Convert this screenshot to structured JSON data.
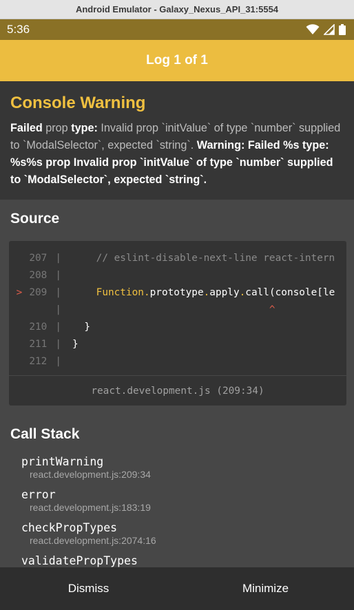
{
  "window": {
    "title": "Android Emulator - Galaxy_Nexus_API_31:5554"
  },
  "statusbar": {
    "time": "5:36",
    "icons": [
      "wifi-icon",
      "signal-icon",
      "battery-icon"
    ]
  },
  "header": {
    "title": "Log 1 of 1"
  },
  "warning": {
    "title": "Console Warning",
    "parts": [
      {
        "text": "Failed ",
        "style": "bright"
      },
      {
        "text": "prop ",
        "style": "dim"
      },
      {
        "text": "type: ",
        "style": "bright"
      },
      {
        "text": "Invalid prop `initValue` of type `number` supplied to `ModalSelector`, expected `string`.",
        "style": "dim"
      },
      {
        "text": " Warning: Failed %s type: %s%s prop Invalid prop `initValue` of type `number` supplied to `ModalSelector`, expected `string`.",
        "style": "bright"
      }
    ]
  },
  "source": {
    "title": "Source",
    "lines": [
      {
        "num": "207",
        "marker": "",
        "code": "    // eslint-disable-next-line react-intern"
      },
      {
        "num": "208",
        "marker": "",
        "code": ""
      },
      {
        "num": "209",
        "marker": ">",
        "code": "    Function.prototype.apply.call(console[le"
      },
      {
        "num": "",
        "marker": "",
        "code": "                                 ^"
      },
      {
        "num": "210",
        "marker": "",
        "code": "  }"
      },
      {
        "num": "211",
        "marker": "",
        "code": "}"
      },
      {
        "num": "212",
        "marker": "",
        "code": ""
      }
    ],
    "file": "react.development.js (209:34)"
  },
  "callstack": {
    "title": "Call Stack",
    "frames": [
      {
        "name": "printWarning",
        "location": "react.development.js:209:34"
      },
      {
        "name": "error",
        "location": "react.development.js:183:19"
      },
      {
        "name": "checkPropTypes",
        "location": "react.development.js:2074:16"
      },
      {
        "name": "validatePropTypes",
        "location": ""
      }
    ]
  },
  "bottombar": {
    "dismiss_label": "Dismiss",
    "minimize_label": "Minimize"
  },
  "colors": {
    "accent": "#ecbd40",
    "statusbar": "#8a7126",
    "warning_title": "#f0c040",
    "background": "#363636",
    "panel": "#474747",
    "code_bg": "#333333",
    "marker": "#e05d4a"
  }
}
